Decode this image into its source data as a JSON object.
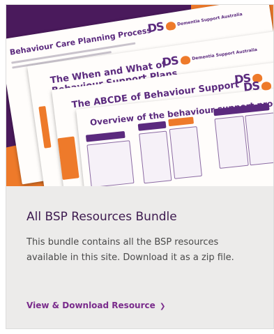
{
  "card": {
    "image": {
      "alt_icon": "bsp-resources-collage",
      "sheet_titles": [
        "Behaviour Care Planning Process",
        "The When and What of Behaviour Support Plans",
        "The ABCDE of Behaviour Support",
        "Overview of the behaviour support process"
      ],
      "brand_mark": "DS",
      "brand_text": "Dementia Support Australia"
    },
    "title": "All BSP Resources Bundle",
    "description": "This bundle contains all the BSP resources available in this site. Download it as a zip file.",
    "link_label": "View & Download Resource",
    "link_chevron": "❯"
  },
  "colors": {
    "brand_purple": "#5b2a7e",
    "brand_orange": "#ee7a2a",
    "title_color": "#3d1a4f",
    "link_color": "#7a2c8c",
    "card_background": "#ecebea"
  }
}
